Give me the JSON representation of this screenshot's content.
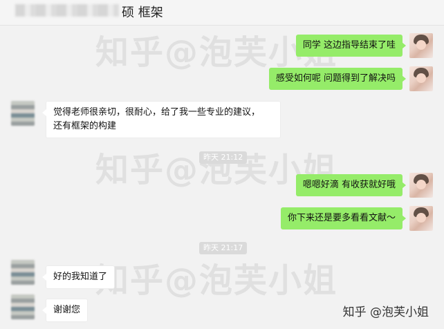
{
  "header": {
    "title": "硕 框架"
  },
  "watermark": "知乎@泡芙小姐",
  "messages": {
    "m1": "同学 这边指导结束了哇",
    "m2": "感受如何呢 问题得到了解决吗",
    "m3_line1": "觉得老师很亲切，很耐心，给了我一些专业的建议，",
    "m3_line2": "还有框架的构建",
    "m4": "嗯嗯好滴 有收获就好哦",
    "m5": "你下来还是要多看看文献～",
    "m6": "好的我知道了",
    "m7": "谢谢您"
  },
  "timestamps": {
    "t1": "昨天 21:12",
    "t2": "昨天 21:17"
  },
  "brand": "知乎 @泡芙小姐",
  "colors": {
    "sent_bubble": "#95ec69",
    "received_bubble": "#ffffff",
    "background": "#f2f2f2"
  }
}
